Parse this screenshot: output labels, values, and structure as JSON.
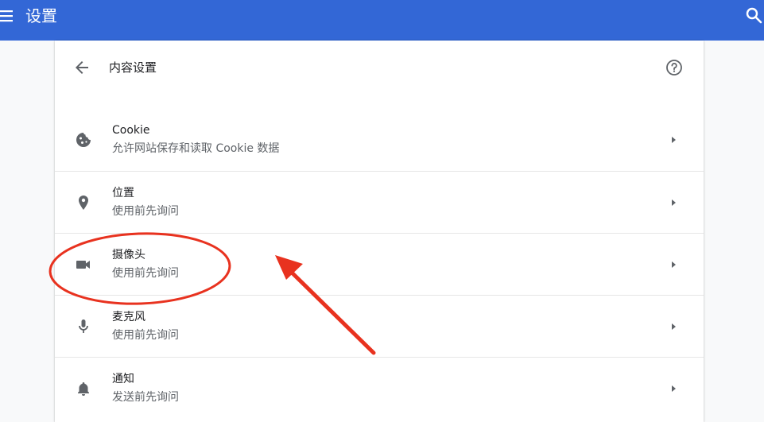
{
  "header": {
    "title": "设置"
  },
  "content": {
    "title": "内容设置"
  },
  "items": [
    {
      "key": "cookie",
      "icon": "cookie-icon",
      "title": "Cookie",
      "subtitle": "允许网站保存和读取 Cookie 数据"
    },
    {
      "key": "location",
      "icon": "location-pin-icon",
      "title": "位置",
      "subtitle": "使用前先询问"
    },
    {
      "key": "camera",
      "icon": "camera-icon",
      "title": "摄像头",
      "subtitle": "使用前先询问"
    },
    {
      "key": "microphone",
      "icon": "microphone-icon",
      "title": "麦克风",
      "subtitle": "使用前先询问"
    },
    {
      "key": "notifications",
      "icon": "bell-icon",
      "title": "通知",
      "subtitle": "发送前先询问"
    }
  ],
  "colors": {
    "header": "#3367d6",
    "annotation": "#e8321f"
  }
}
